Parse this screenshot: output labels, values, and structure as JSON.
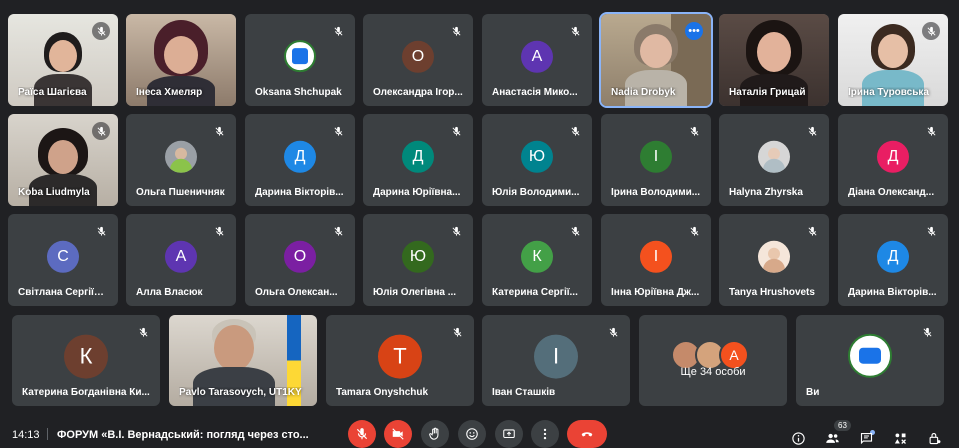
{
  "meeting": {
    "time": "14:13",
    "title": "ФОРУМ «В.І. Вернадський: погляд через сто...",
    "participant_count": "63",
    "more_label": "Ще 34 особи",
    "more_avatar_letter": "А"
  },
  "colors": {
    "tile_bg": "#3c4043",
    "app_bg": "#202124",
    "hangup_red": "#ea4335",
    "accent_blue": "#1a73e8"
  },
  "participants": [
    {
      "name": "Раїса Шагієва",
      "type": "video"
    },
    {
      "name": "Інеса Хмеляр",
      "type": "video"
    },
    {
      "name": "Oksana Shchupak",
      "type": "logo"
    },
    {
      "name": "Олександра Ігор...",
      "letter": "О",
      "color": "#6d3f2f"
    },
    {
      "name": "Анастасія Мико...",
      "letter": "А",
      "color": "#5e35b1"
    },
    {
      "name": "Nadia Drobyk",
      "type": "video"
    },
    {
      "name": "Наталія Грицай",
      "type": "video"
    },
    {
      "name": "Ірина Туровська",
      "type": "video"
    },
    {
      "name": "Koba Liudmyla",
      "type": "video"
    },
    {
      "name": "Ольга Пшеничняк",
      "type": "photo"
    },
    {
      "name": "Дарина Вікторів...",
      "letter": "Д",
      "color": "#1e88e5"
    },
    {
      "name": "Дарина Юріївна...",
      "letter": "Д",
      "color": "#00897b"
    },
    {
      "name": "Юлія Володими...",
      "letter": "Ю",
      "color": "#00838f"
    },
    {
      "name": "Ірина Володими...",
      "letter": "І",
      "color": "#2e7d32"
    },
    {
      "name": "Halyna Zhyrska",
      "type": "photo"
    },
    {
      "name": "Діана Олександ...",
      "letter": "Д",
      "color": "#e91e63"
    },
    {
      "name": "Світлана Сергіїв...",
      "letter": "С",
      "color": "#5c6bc0"
    },
    {
      "name": "Алла Власюк",
      "letter": "А",
      "color": "#5e35b1"
    },
    {
      "name": "Ольга Олексан...",
      "letter": "О",
      "color": "#7b1fa2"
    },
    {
      "name": "Юлія Олегівна ...",
      "letter": "Ю",
      "color": "#33691e"
    },
    {
      "name": "Катерина Сергії...",
      "letter": "К",
      "color": "#43a047"
    },
    {
      "name": "Інна Юріївна Дж...",
      "letter": "І",
      "color": "#f4511e"
    },
    {
      "name": "Tanya Hrushovets",
      "type": "photo"
    },
    {
      "name": "Дарина Вікторів...",
      "letter": "Д",
      "color": "#1e88e5"
    },
    {
      "name": "Катерина Богданівна Ки...",
      "letter": "К",
      "color": "#6d3f2f"
    },
    {
      "name": "Pavlo Tarasovych, UT1KY",
      "type": "video"
    },
    {
      "name": "Tamara Onyshchuk",
      "letter": "Т",
      "color": "#d84315"
    },
    {
      "name": "Іван Сташків",
      "letter": "І",
      "color": "#546e7a"
    },
    {
      "name": "Ви",
      "type": "logo"
    }
  ]
}
